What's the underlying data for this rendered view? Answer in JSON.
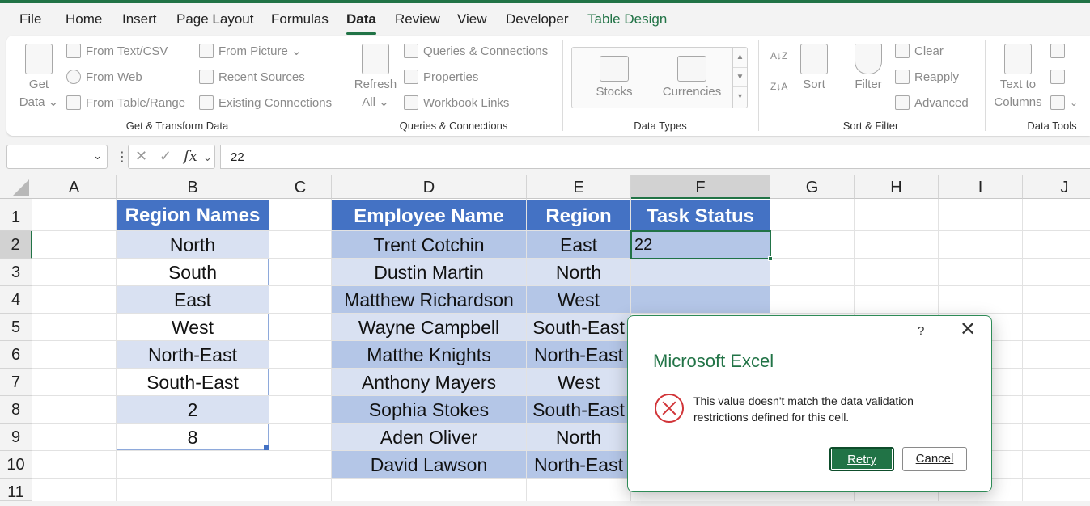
{
  "tabs": [
    "File",
    "Home",
    "Insert",
    "Page Layout",
    "Formulas",
    "Data",
    "Review",
    "View",
    "Developer",
    "Table Design"
  ],
  "ribbon": {
    "get_transform": {
      "get_data": [
        "Get",
        "Data ⌄"
      ],
      "from_text_csv": "From Text/CSV",
      "from_web": "From Web",
      "from_table_range": "From Table/Range",
      "from_picture": "From Picture ⌄",
      "recent_sources": "Recent Sources",
      "existing_connections": "Existing Connections",
      "group_label": "Get & Transform Data"
    },
    "queries": {
      "refresh_all": [
        "Refresh",
        "All ⌄"
      ],
      "queries_connections": "Queries & Connections",
      "properties": "Properties",
      "workbook_links": "Workbook Links",
      "group_label": "Queries & Connections"
    },
    "data_types": {
      "stocks": "Stocks",
      "currencies": "Currencies",
      "group_label": "Data Types"
    },
    "sort_filter": {
      "sort": "Sort",
      "filter": "Filter",
      "clear": "Clear",
      "reapply": "Reapply",
      "advanced": "Advanced",
      "group_label": "Sort & Filter"
    },
    "data_tools": {
      "text_to_columns": [
        "Text to",
        "Columns"
      ],
      "group_label": "Data Tools"
    }
  },
  "formula_bar": {
    "name_box": "",
    "value": "22"
  },
  "columns": [
    "A",
    "B",
    "C",
    "D",
    "E",
    "F",
    "G",
    "H",
    "I",
    "J"
  ],
  "rows": [
    "1",
    "2",
    "3",
    "4",
    "5",
    "6",
    "7",
    "8",
    "9",
    "10",
    "11"
  ],
  "region_table": {
    "header": "Region Names",
    "values": [
      "North",
      "South",
      "East",
      "West",
      "North-East",
      "South-East",
      "2",
      "8"
    ]
  },
  "employee_table": {
    "headers": [
      "Employee Name",
      "Region",
      "Task Status"
    ],
    "rows": [
      [
        "Trent Cotchin",
        "East",
        "22"
      ],
      [
        "Dustin Martin",
        "North",
        ""
      ],
      [
        "Matthew Richardson",
        "West",
        ""
      ],
      [
        "Wayne Campbell",
        "South-East",
        ""
      ],
      [
        "Matthe Knights",
        "North-East",
        ""
      ],
      [
        "Anthony Mayers",
        "West",
        ""
      ],
      [
        "Sophia Stokes",
        "South-East",
        ""
      ],
      [
        "Aden Oliver",
        "North",
        ""
      ],
      [
        "David Lawson",
        "North-East",
        ""
      ]
    ]
  },
  "dialog": {
    "help": "?",
    "title": "Microsoft Excel",
    "message": "This value doesn't match the data validation restrictions defined for this cell.",
    "retry": "Retry",
    "cancel": "Cancel"
  },
  "colors": {
    "accent": "#217346",
    "table_header": "#4472c4",
    "band_light": "#d9e1f2",
    "band_dark": "#b4c6e7",
    "error": "#d13438"
  }
}
